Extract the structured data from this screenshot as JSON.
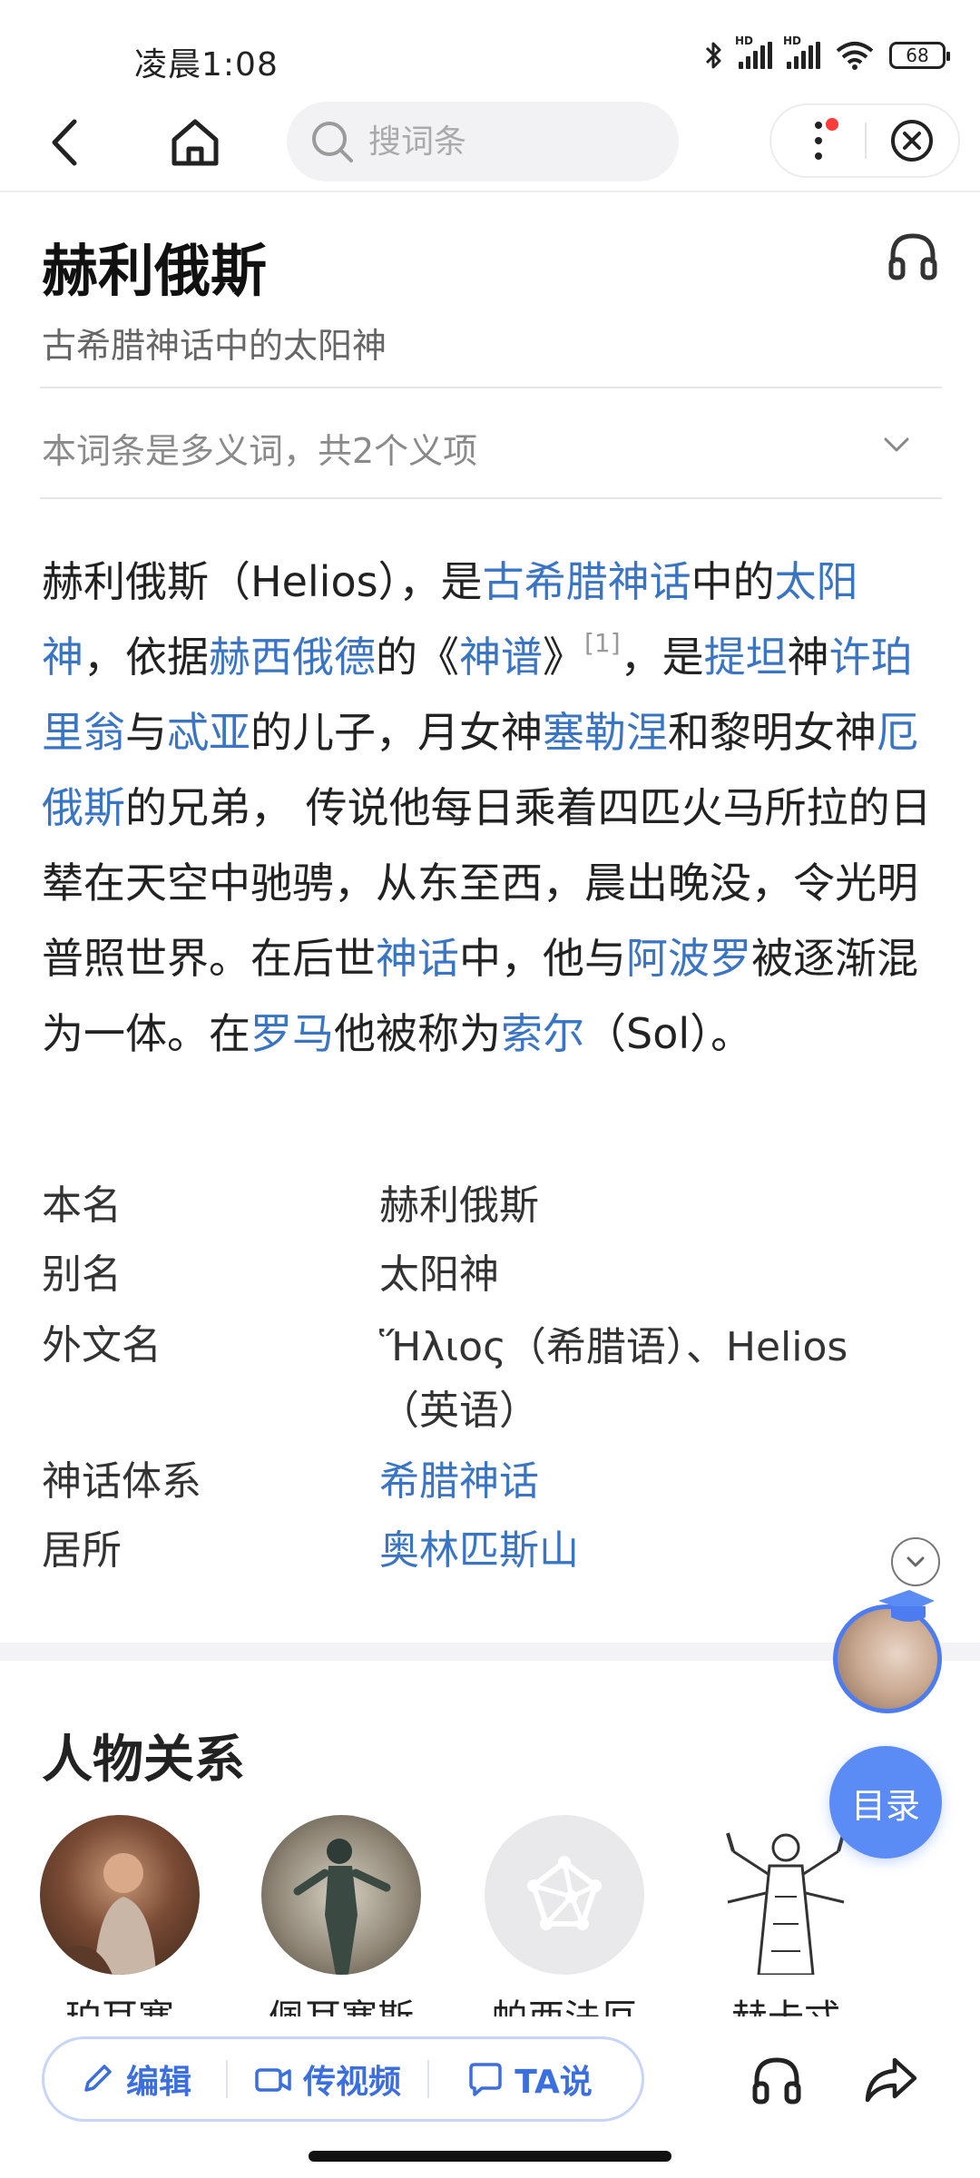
{
  "status_bar": {
    "time": "凌晨1:08",
    "battery": "68",
    "hd1": "HD",
    "hd2": "HD"
  },
  "nav": {
    "search_placeholder": "搜词条"
  },
  "entry": {
    "title": "赫利俄斯",
    "subtitle": "古希腊神话中的太阳神",
    "polysemy": "本词条是多义词，共2个义项"
  },
  "summary": {
    "s1": "赫利俄斯（Helios），是",
    "l1": "古希腊神话",
    "s2": "中的",
    "l2": "太阳神",
    "s3": "，依据",
    "l3": "赫西俄德",
    "s4": "的《",
    "l4": "神谱",
    "s5": "》",
    "ref": "[1]",
    "s6": "，是",
    "l5": "提坦",
    "s7": "神",
    "l6": "许珀里翁",
    "s8": "与",
    "l7": "忒亚",
    "s9": "的儿子，月女神",
    "l8": "塞勒涅",
    "s10": "和黎明女神",
    "l9": "厄俄斯",
    "s11": "的兄弟， 传说他每日乘着四匹火马所拉的日辇在天空中驰骋，从东至西，晨出晚没，令光明普照世界。在后世",
    "l10": "神话",
    "s12": "中，他与",
    "l11": "阿波罗",
    "s13": "被逐渐混为一体。在",
    "l12": "罗马",
    "s14": "他被称为",
    "l13": "索尔",
    "s15": "（Sol）。"
  },
  "infobox": [
    {
      "label": "本名",
      "value": "赫利俄斯"
    },
    {
      "label": "别名",
      "value": "太阳神"
    },
    {
      "label": "外文名",
      "value": "Ἥλιος（希腊语）、Helios（英语）"
    },
    {
      "label": "神话体系",
      "value": "希腊神话"
    },
    {
      "label": "居所",
      "value": "奥林匹斯山"
    }
  ],
  "relations": {
    "title": "人物关系",
    "people": [
      {
        "name": "珀耳塞"
      },
      {
        "name": "佩耳塞斯"
      },
      {
        "name": "帕西法厄"
      },
      {
        "name": "赫卡忒"
      }
    ]
  },
  "floating": {
    "toc_label": "目录"
  },
  "bottom_bar": {
    "edit_label": "编辑",
    "video_label": "传视频",
    "ta_label": "TA说"
  },
  "colors": {
    "link": "#3a75c4",
    "accent": "#5b8cf5",
    "action_text": "#3b6fe0"
  }
}
